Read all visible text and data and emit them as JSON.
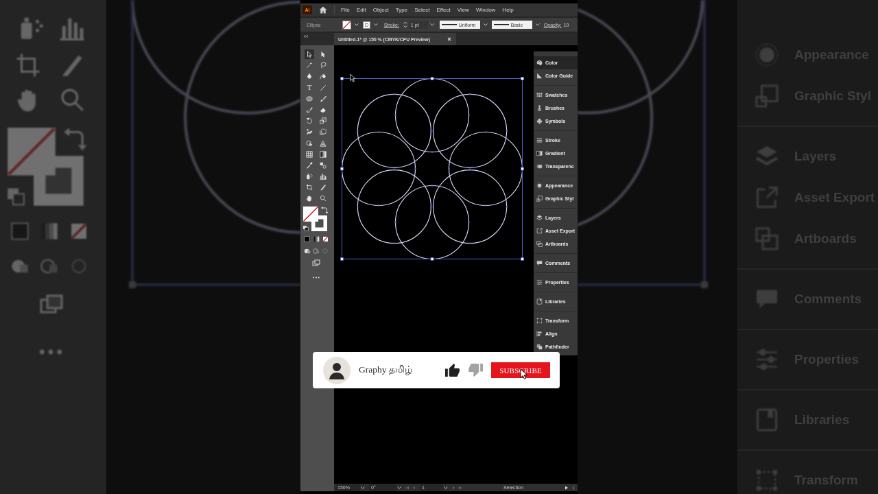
{
  "backdrop": {
    "panel_groups": [
      [
        {
          "label": "Appearance",
          "kind": "appearance"
        },
        {
          "label": "Graphic Styl",
          "kind": "styles"
        }
      ],
      [
        {
          "label": "Layers",
          "kind": "layers"
        },
        {
          "label": "Asset Export",
          "kind": "export"
        },
        {
          "label": "Artboards",
          "kind": "artboards"
        }
      ],
      [
        {
          "label": "Comments",
          "kind": "comments"
        }
      ],
      [
        {
          "label": "Properties",
          "kind": "properties"
        }
      ],
      [
        {
          "label": "Libraries",
          "kind": "libraries"
        }
      ],
      [
        {
          "label": "Transform",
          "kind": "transform"
        }
      ]
    ]
  },
  "app": {
    "logo": "Ai",
    "menu": [
      "File",
      "Edit",
      "Object",
      "Type",
      "Select",
      "Effect",
      "View",
      "Window",
      "Help"
    ],
    "control_bar": {
      "tool_name": "Ellipse",
      "stroke_label": "Stroke:",
      "stroke_weight": "1 pt",
      "profile": "Uniform",
      "brush": "Basic",
      "opacity_label": "Opacity:",
      "opacity_value": "10"
    },
    "document_tab": {
      "title": "Untitled-1* @ 150 % (CMYK/CPU Preview)"
    },
    "tools": [
      {
        "selected": true
      },
      {
        "selected": false
      },
      {
        "selected": false
      },
      {
        "selected": false
      },
      {
        "selected": false
      },
      {
        "selected": false
      },
      {
        "selected": false,
        "glyph": "T"
      },
      {
        "selected": false
      },
      {
        "selected": false
      },
      {
        "selected": false
      },
      {
        "selected": false
      },
      {
        "selected": false
      },
      {
        "selected": false
      },
      {
        "selected": false
      },
      {
        "selected": false
      },
      {
        "selected": false
      },
      {
        "selected": false
      },
      {
        "selected": false
      },
      {
        "selected": false
      },
      {
        "selected": false
      },
      {
        "selected": false
      },
      {
        "selected": false
      },
      {
        "selected": false
      },
      {
        "selected": false
      },
      {
        "selected": false
      },
      {
        "selected": false
      },
      {
        "selected": false
      },
      {
        "selected": false
      }
    ],
    "panel_groups": [
      [
        {
          "label": "Color",
          "kind": "color",
          "selected": true
        },
        {
          "label": "Color Guide",
          "kind": "guide",
          "selected": false
        }
      ],
      [
        {
          "label": "Swatches",
          "kind": "swatches",
          "selected": false
        },
        {
          "label": "Brushes",
          "kind": "brushes",
          "selected": false
        },
        {
          "label": "Symbols",
          "kind": "symbols",
          "selected": false
        }
      ],
      [
        {
          "label": "Stroke",
          "kind": "stroke",
          "selected": false
        },
        {
          "label": "Gradient",
          "kind": "gradient",
          "selected": false
        },
        {
          "label": "Transparenc",
          "kind": "transparency",
          "selected": false
        }
      ],
      [
        {
          "label": "Appearance",
          "kind": "appearance",
          "selected": false
        },
        {
          "label": "Graphic Styl",
          "kind": "styles",
          "selected": false
        }
      ],
      [
        {
          "label": "Layers",
          "kind": "layers",
          "selected": false
        },
        {
          "label": "Asset Export",
          "kind": "export",
          "selected": false
        },
        {
          "label": "Artboards",
          "kind": "artboards",
          "selected": false
        }
      ],
      [
        {
          "label": "Comments",
          "kind": "comments",
          "selected": false
        }
      ],
      [
        {
          "label": "Properties",
          "kind": "properties",
          "selected": false
        }
      ],
      [
        {
          "label": "Libraries",
          "kind": "libraries",
          "selected": false
        }
      ],
      [
        {
          "label": "Transform",
          "kind": "transform",
          "selected": false
        },
        {
          "label": "Align",
          "kind": "align",
          "selected": false
        },
        {
          "label": "Pathfinder",
          "kind": "pathfinder",
          "selected": false
        }
      ]
    ],
    "status_bar": {
      "zoom": "150%",
      "rotation": "0°",
      "artboard": "1",
      "mode": "Selection"
    }
  },
  "subscribe_card": {
    "channel": "Graphy தமிழ்",
    "button": "SUBSCRIBE"
  }
}
